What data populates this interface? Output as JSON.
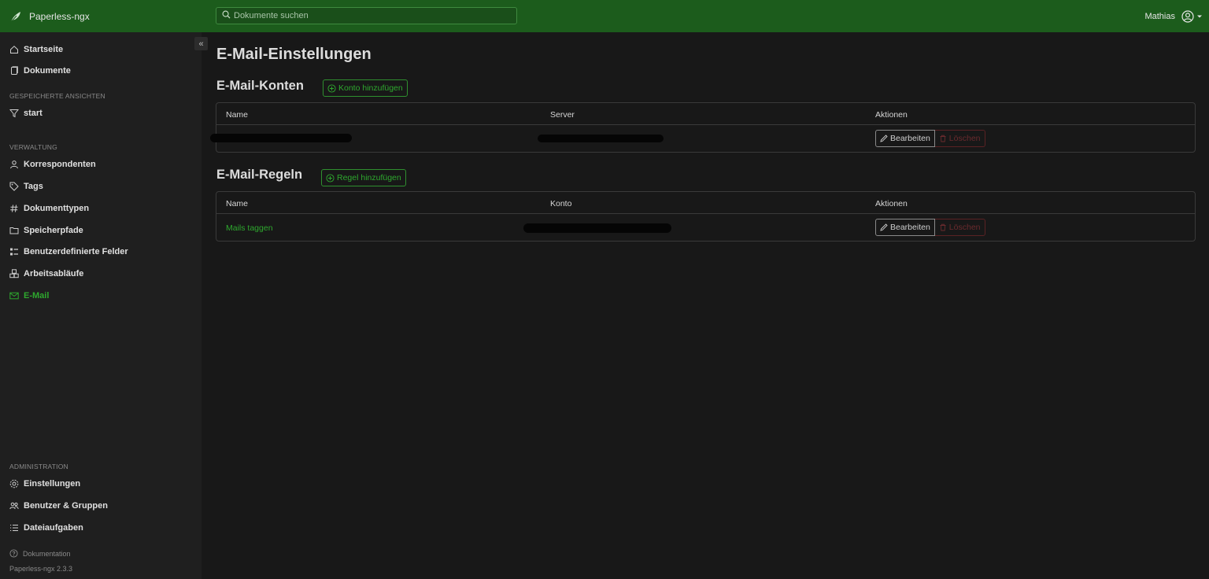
{
  "app": {
    "name": "Paperless-ngx",
    "version": "Paperless-ngx 2.3.3"
  },
  "search": {
    "placeholder": "Dokumente suchen"
  },
  "user": {
    "name": "Mathias"
  },
  "sidebar": {
    "top_items": [
      {
        "label": "Startseite",
        "icon": "home-icon"
      },
      {
        "label": "Dokumente",
        "icon": "documents-icon"
      }
    ],
    "saved_views_label": "GESPEICHERTE ANSICHTEN",
    "saved_views": [
      {
        "label": "start",
        "icon": "filter-icon"
      }
    ],
    "management_label": "VERWALTUNG",
    "management_items": [
      {
        "label": "Korrespondenten",
        "icon": "person-icon"
      },
      {
        "label": "Tags",
        "icon": "tag-icon"
      },
      {
        "label": "Dokumenttypen",
        "icon": "hash-icon"
      },
      {
        "label": "Speicherpfade",
        "icon": "folder-icon"
      },
      {
        "label": "Benutzerdefinierte Felder",
        "icon": "ui-checks-icon"
      },
      {
        "label": "Arbeitsabläufe",
        "icon": "boxes-icon"
      },
      {
        "label": "E-Mail",
        "icon": "envelope-icon",
        "active": true
      }
    ],
    "admin_label": "ADMINISTRATION",
    "admin_items": [
      {
        "label": "Einstellungen",
        "icon": "gear-icon"
      },
      {
        "label": "Benutzer & Gruppen",
        "icon": "people-icon"
      },
      {
        "label": "Dateiaufgaben",
        "icon": "list-task-icon"
      }
    ],
    "docs_link": "Dokumentation"
  },
  "main": {
    "title": "E-Mail-Einstellungen",
    "accounts": {
      "title": "E-Mail-Konten",
      "add_label": "Konto hinzufügen",
      "columns": [
        "Name",
        "Server",
        "Aktionen"
      ],
      "rows": [
        {
          "name": "",
          "server": "",
          "redacted": true
        }
      ]
    },
    "rules": {
      "title": "E-Mail-Regeln",
      "add_label": "Regel hinzufügen",
      "columns": [
        "Name",
        "Konto",
        "Aktionen"
      ],
      "rows": [
        {
          "name": "Mails taggen",
          "account": "",
          "redacted": true
        }
      ]
    },
    "actions": {
      "edit_label": "Bearbeiten",
      "delete_label": "Löschen"
    }
  },
  "colors": {
    "topbar": "#1c5c1c",
    "accent": "#2ea82e",
    "danger": "#6b2b2e",
    "background": "#181818",
    "sidebar": "#1f1f1f"
  }
}
